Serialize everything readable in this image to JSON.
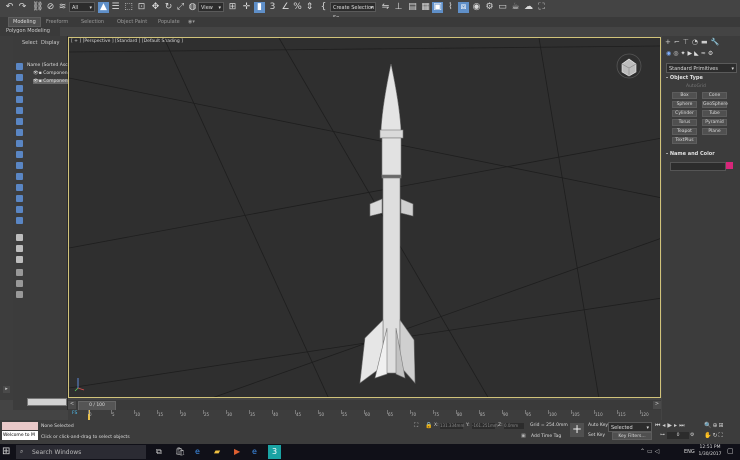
{
  "toolbar": {
    "filter_value": "All",
    "view_value": "View",
    "selection_set_placeholder": "Create Selection Se"
  },
  "ribbon": {
    "tabs": [
      "Modeling",
      "Freeform",
      "Selection",
      "Object Paint",
      "Populate"
    ],
    "sub_label": "Polygon Modeling"
  },
  "explorer": {
    "tabs": [
      "Select",
      "Display"
    ],
    "column_header": "Name (Sorted Ascen",
    "rows": [
      "Componen",
      "Componen"
    ]
  },
  "viewport": {
    "label": "[ + ] [Perspective ] [Standard ] [Default Shading ]"
  },
  "command_panel": {
    "category": "Standard Primitives",
    "object_type_title": "Object Type",
    "autogrid": "AutoGrid",
    "buttons": [
      "Box",
      "Cone",
      "Sphere",
      "GeoSphere",
      "Cylinder",
      "Tube",
      "Torus",
      "Pyramid",
      "Teapot",
      "Plane",
      "TextPlus"
    ],
    "name_color_title": "Name and Color",
    "swatch_color": "#d8267a"
  },
  "timeline": {
    "frame": "0 / 100",
    "ticks": [
      "0",
      "5",
      "10",
      "15",
      "20",
      "25",
      "30",
      "35",
      "40",
      "45",
      "50",
      "55",
      "60",
      "65",
      "70",
      "75",
      "80",
      "85",
      "90",
      "95",
      "100",
      "105",
      "110",
      "115",
      "120"
    ]
  },
  "status": {
    "script_listener": "Welcome to M",
    "selection": "None Selected",
    "prompt": "Click or click-and-drag to select objects",
    "x_label": "X:",
    "y_label": "Y:",
    "z_label": "Z:",
    "x_value": "131.334mm",
    "y_value": "-161.251mm",
    "z_value": "0.0mm",
    "grid": "Grid = 254.0mm",
    "add_time_tag": "Add Time Tag",
    "auto_key": "Auto Key",
    "set_key": "Set Key",
    "selected_value": "Selected",
    "key_filters": "Key Filters...",
    "frame_field": "0"
  },
  "taskbar": {
    "search_text": "Search Windows",
    "lang": "ENG",
    "time": "12:51 PM",
    "date": "1/30/2017"
  }
}
